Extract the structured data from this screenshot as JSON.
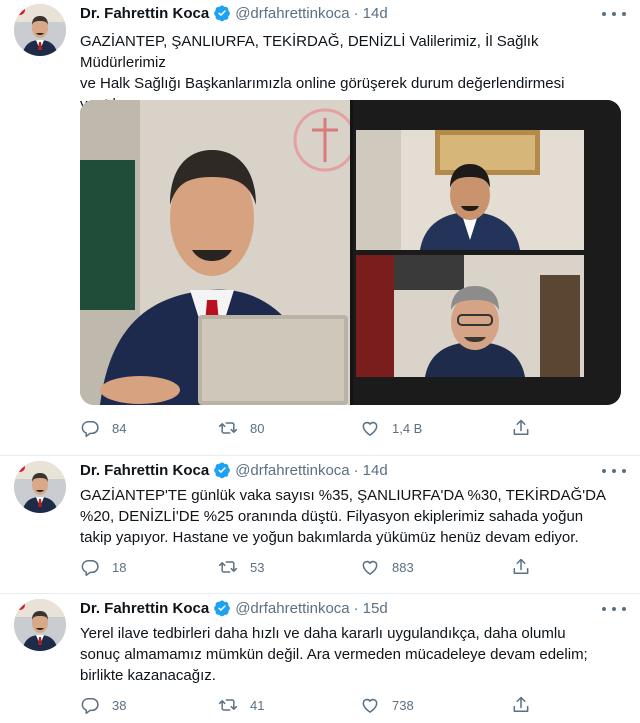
{
  "tweets": [
    {
      "author_name": "Dr. Fahrettin Koca",
      "handle": "@drfahrettinkoca",
      "separator": "·",
      "time": "14d",
      "text": "GAZİANTEP, ŞANLIURFA, TEKİRDAĞ, DENİZLİ Valilerimiz, İl Sağlık Müdürlerimiz\nve Halk Sağlığı Başkanlarımızla online görüşerek durum değerlendirmesi\nyaptık.",
      "replies": "84",
      "retweets": "80",
      "likes": "1,4 B"
    },
    {
      "author_name": "Dr. Fahrettin Koca",
      "handle": "@drfahrettinkoca",
      "separator": "·",
      "time": "14d",
      "text": "GAZİANTEP'TE günlük vaka sayısı %35, ŞANLIURFA'DA %30, TEKİRDAĞ'DA\n%20, DENİZLİ'DE %25 oranında düştü. Filyasyon ekiplerimiz sahada yoğun\ntakip yapıyor. Hastane ve yoğun bakımlarda yükümüz henüz devam ediyor.",
      "replies": "18",
      "retweets": "53",
      "likes": "883"
    },
    {
      "author_name": "Dr. Fahrettin Koca",
      "handle": "@drfahrettinkoca",
      "separator": "·",
      "time": "15d",
      "text": "Yerel ilave tedbirleri daha hızlı ve daha kararlı uygulandıkça, daha olumlu\nsonuç almamamız mümkün değil. Ara vermeden mücadeleye devam edelim;\nbirlikte kazanacağız.",
      "replies": "38",
      "retweets": "41",
      "likes": "738"
    }
  ],
  "colors": {
    "verified_blue": "#1da1f2",
    "muted_text": "#5b7083",
    "border": "#e6ecf0"
  },
  "icons": [
    "verified-badge-icon",
    "more-options-icon",
    "reply-icon",
    "retweet-icon",
    "like-icon",
    "share-icon"
  ]
}
